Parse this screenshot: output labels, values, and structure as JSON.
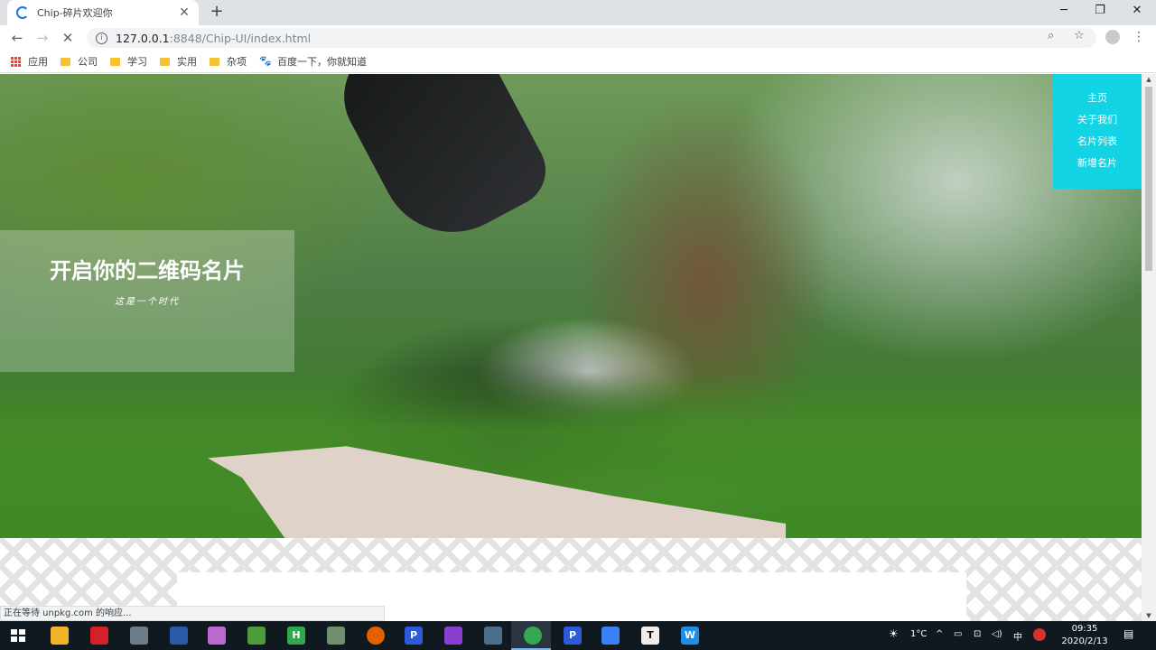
{
  "browser": {
    "tab": {
      "title": "Chip-碎片欢迎你",
      "close": "✕"
    },
    "new_tab": "+",
    "window_controls": {
      "minimize": "─",
      "maximize": "❐",
      "close": "✕"
    },
    "nav": {
      "back": "←",
      "forward": "→",
      "reload": "✕"
    },
    "url": {
      "host": "127.0.0.1",
      "path": ":8848/Chip-UI/index.html"
    },
    "omnibox_icons": {
      "info": "i",
      "zoom": "⌕",
      "star": "☆"
    },
    "menu": "⋮",
    "bookmarks": [
      {
        "label": "应用",
        "icon": "apps-grid-icon"
      },
      {
        "label": "公司",
        "icon": "folder-icon"
      },
      {
        "label": "学习",
        "icon": "folder-icon"
      },
      {
        "label": "实用",
        "icon": "folder-icon"
      },
      {
        "label": "杂项",
        "icon": "folder-icon"
      },
      {
        "label": "百度一下，你就知道",
        "icon": "baidu-paw-icon"
      }
    ],
    "status_text": "正在等待 unpkg.com 的响应..."
  },
  "page": {
    "hero_title": "开启你的二维码名片",
    "hero_subtitle": "这是一个时代",
    "nav_items": [
      "主页",
      "关于我们",
      "名片列表",
      "新增名片"
    ]
  },
  "taskbar": {
    "apps": [
      "file-explorer",
      "youdao",
      "app-3",
      "app-4",
      "app-5",
      "app-6",
      "hbuilder",
      "app-8",
      "firefox",
      "app-p",
      "intellij",
      "app-12",
      "chrome",
      "app-p2",
      "app-15",
      "typora",
      "app-w"
    ],
    "tray": {
      "temperature": "1°C",
      "ime": "中",
      "caret": "^"
    },
    "clock": {
      "time": "09:35",
      "date": "2020/2/13"
    }
  },
  "colors": {
    "accent_nav": "#13d4e4",
    "taskbar": "#101820"
  }
}
